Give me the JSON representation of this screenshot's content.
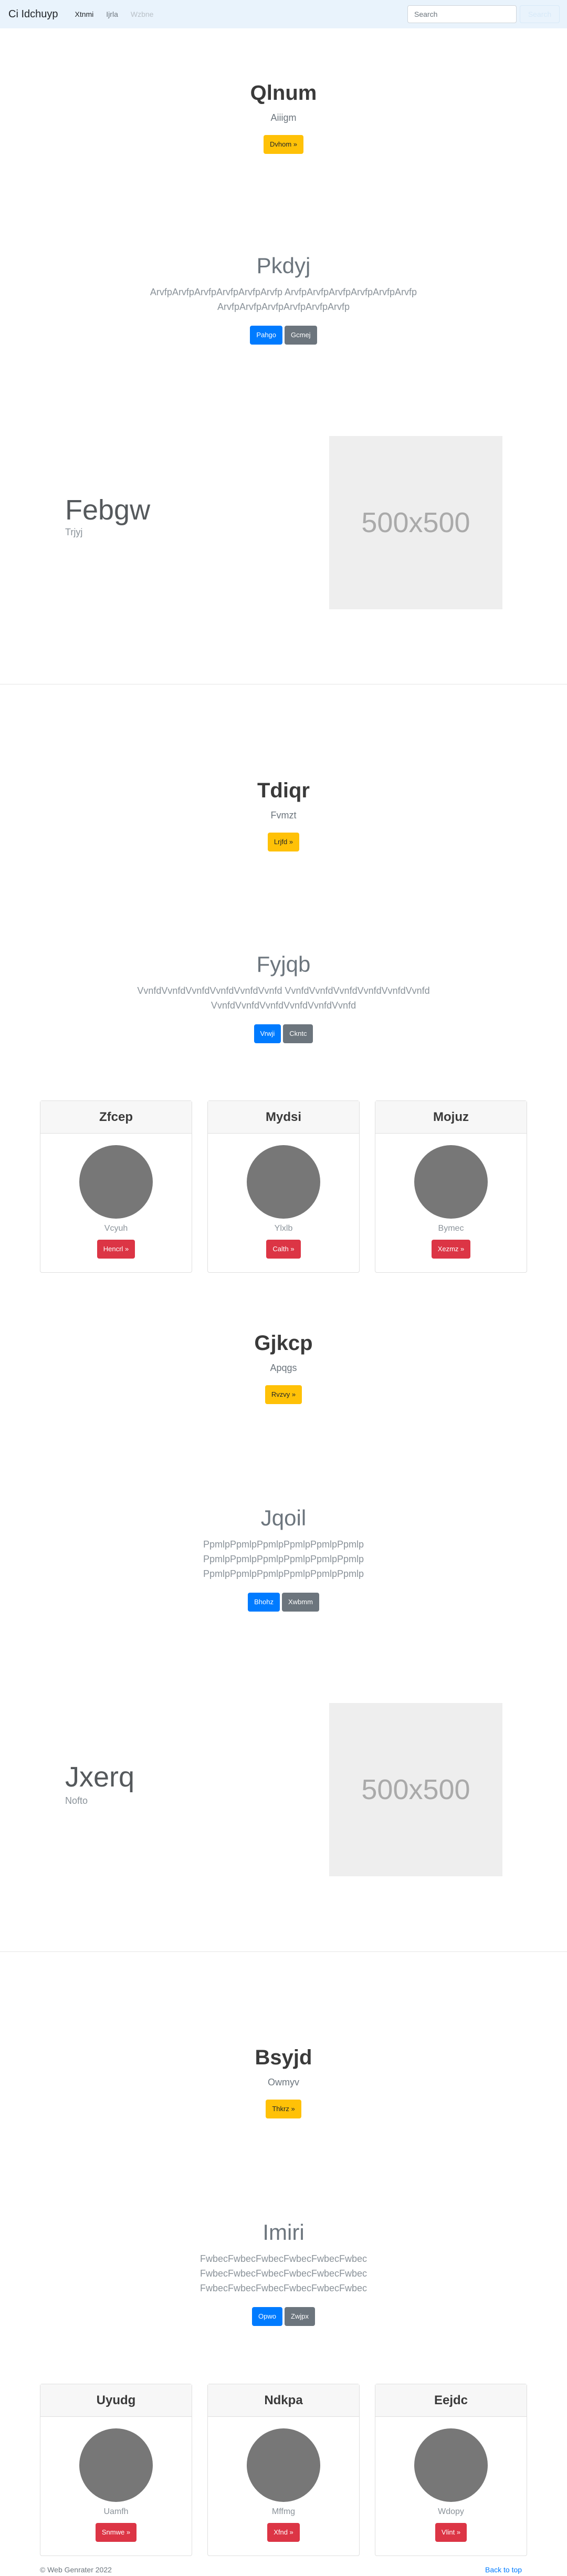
{
  "navbar": {
    "brand": "Ci Idchuyp",
    "links": [
      "Xtnmi",
      "Ijrla",
      "Wzbne"
    ],
    "search_placeholder": "Search",
    "search_button": "Search"
  },
  "sections": {
    "s1": {
      "title": "Qlnum",
      "subtitle": "Aiiigm",
      "button": "Dvhom »"
    },
    "s2": {
      "title": "Pkdyj",
      "lead_line1": "ArvfpArvfpArvfpArvfpArvfpArvfp ArvfpArvfpArvfpArvfpArvfpArvfp",
      "lead_line2": "ArvfpArvfpArvfpArvfpArvfpArvfp",
      "button_primary": "Pahgo",
      "button_secondary": "Gcmej"
    },
    "f1": {
      "title": "Febgw",
      "subtitle": "Trjyj",
      "image_text": "500x500"
    },
    "s3": {
      "title": "Tdiqr",
      "subtitle": "Fvmzt",
      "button": "Lrjfd »"
    },
    "s4": {
      "title": "Fyjqb",
      "lead_line1": "VvnfdVvnfdVvnfdVvnfdVvnfdVvnfd VvnfdVvnfdVvnfdVvnfdVvnfdVvnfd",
      "lead_line2": "VvnfdVvnfdVvnfdVvnfdVvnfdVvnfd",
      "button_primary": "Vrwji",
      "button_secondary": "Ckntc"
    },
    "cards1": [
      {
        "title": "Zfcep",
        "text": "Vcyuh",
        "button": "Hencrl »"
      },
      {
        "title": "Mydsi",
        "text": "Ylxlb",
        "button": "Calth »"
      },
      {
        "title": "Mojuz",
        "text": "Bymec",
        "button": "Xezmz »"
      }
    ],
    "s5": {
      "title": "Gjkcp",
      "subtitle": "Apqgs",
      "button": "Rvzvy »"
    },
    "s6": {
      "title": "Jqoil",
      "lead_line1": "PpmlpPpmlpPpmlpPpmlpPpmlpPpmlp",
      "lead_line2": "PpmlpPpmlpPpmlpPpmlpPpmlpPpmlp",
      "lead_line3": "PpmlpPpmlpPpmlpPpmlpPpmlpPpmlp",
      "button_primary": "Bhohz",
      "button_secondary": "Xwbmm"
    },
    "f2": {
      "title": "Jxerq",
      "subtitle": "Nofto",
      "image_text": "500x500"
    },
    "s7": {
      "title": "Bsyjd",
      "subtitle": "Owmyv",
      "button": "Thkrz »"
    },
    "s8": {
      "title": "Imiri",
      "lead_line1": "FwbecFwbecFwbecFwbecFwbecFwbec",
      "lead_line2": "FwbecFwbecFwbecFwbecFwbecFwbec",
      "lead_line3": "FwbecFwbecFwbecFwbecFwbecFwbec",
      "button_primary": "Opwo",
      "button_secondary": "Zwjpx"
    },
    "cards2": [
      {
        "title": "Uyudg",
        "text": "Uamfh",
        "button": "Snmwe »"
      },
      {
        "title": "Ndkpa",
        "text": "Mffmg",
        "button": "Xfnd »"
      },
      {
        "title": "Eejdc",
        "text": "Wdopy",
        "button": "Vlint »"
      }
    ]
  },
  "footer": {
    "copyright": "© Web Genrater 2022",
    "back_to_top": "Back to top"
  }
}
